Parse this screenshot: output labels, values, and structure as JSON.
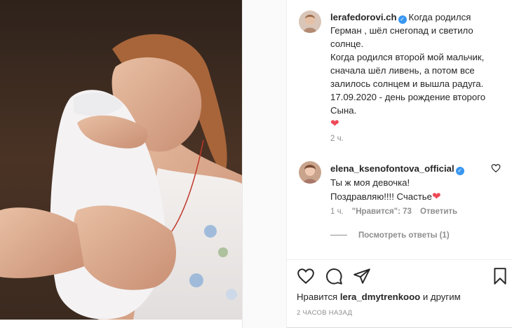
{
  "post": {
    "author": "lerafedorovi.ch",
    "caption_lines": [
      "Когда родился",
      "Герман , шёл снегопад и светило солнце.",
      "Когда родился второй мой мальчик, сначала шёл ливень, а потом все залилось солнцем и вышла радуга.",
      "17.09.2020 - день рождение второго Сына."
    ],
    "caption_emoji": "❤",
    "time_ago": "2 ч."
  },
  "comment": {
    "author": "elena_ksenofontova_official",
    "text_line1": "Ты ж моя девочка!",
    "text_line2": "Поздравляю!!!! Счастье",
    "emoji": "❤",
    "time": "1 ч.",
    "likes": "\"Нравится\": 73",
    "reply": "Ответить",
    "view_replies": "Посмотреть ответы (1)"
  },
  "actions": {
    "like_icon": "heart-outline-icon",
    "comment_icon": "comment-bubble-icon",
    "share_icon": "paper-plane-icon",
    "save_icon": "bookmark-icon"
  },
  "footer": {
    "likes_prefix": "Нравится",
    "likes_user": "lera_dmytrenkooo",
    "likes_suffix": "и другим",
    "posted_ago": "2 ЧАСОВ НАЗАД"
  },
  "colors": {
    "verified": "#3897f0",
    "heart": "#ed4956",
    "muted": "#8e8e8e",
    "text": "#262626"
  }
}
